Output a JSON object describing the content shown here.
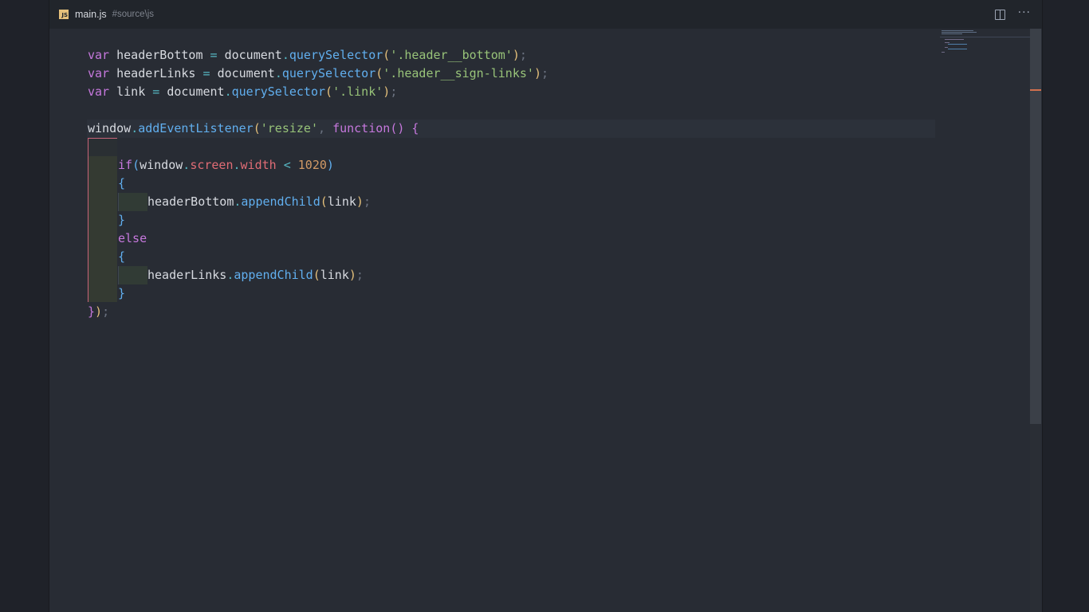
{
  "tab": {
    "icon": "javascript-file-icon",
    "icon_text": "JS",
    "filename": "main.js",
    "path": "#source\\js"
  },
  "actions": {
    "split_icon": "split-editor-icon",
    "more_icon": "more-actions-icon",
    "more_glyph": "···"
  },
  "code": {
    "l1": {
      "kw": "var",
      "name": "headerBottom",
      "eq": "=",
      "obj": "document",
      "dot": ".",
      "fn": "querySelector",
      "open": "(",
      "str": "'.header__bottom'",
      "close": ")",
      "semi": ";"
    },
    "l2": {
      "kw": "var",
      "name": "headerLinks",
      "eq": "=",
      "obj": "document",
      "dot": ".",
      "fn": "querySelector",
      "open": "(",
      "str": "'.header__sign-links'",
      "close": ")",
      "semi": ";"
    },
    "l3": {
      "kw": "var",
      "name": "link",
      "eq": "=",
      "obj": "document",
      "dot": ".",
      "fn": "querySelector",
      "open": "(",
      "str": "'.link'",
      "close": ")",
      "semi": ";"
    },
    "l5": {
      "obj": "window",
      "dot": ".",
      "fn": "addEventListener",
      "open": "(",
      "str": "'resize'",
      "comma": ",",
      "kw": "function",
      "parens": "()",
      "brace": "{"
    },
    "l7": {
      "kw": "if",
      "open": "(",
      "obj": "window",
      "dot1": ".",
      "prop1": "screen",
      "dot2": ".",
      "prop2": "width",
      "op": "<",
      "num": "1020",
      "close": ")"
    },
    "l8": {
      "brace": "{"
    },
    "l9": {
      "obj": "headerBottom",
      "dot": ".",
      "fn": "appendChild",
      "open": "(",
      "arg": "link",
      "close": ")",
      "semi": ";"
    },
    "l10": {
      "brace": "}"
    },
    "l11": {
      "kw": "else"
    },
    "l12": {
      "brace": "{"
    },
    "l13": {
      "obj": "headerLinks",
      "dot": ".",
      "fn": "appendChild",
      "open": "(",
      "arg": "link",
      "close": ")",
      "semi": ";"
    },
    "l14": {
      "brace": "}"
    },
    "l15": {
      "brace": "}",
      "paren": ")",
      "semi": ";"
    }
  },
  "colors": {
    "editor_bg": "#282c34",
    "keyword": "#c678dd",
    "function": "#61afef",
    "string": "#98c379",
    "number": "#d19a66",
    "property": "#e06c75",
    "bracket_guide": "#c8647a",
    "scroll_marker": "#d2704e"
  }
}
